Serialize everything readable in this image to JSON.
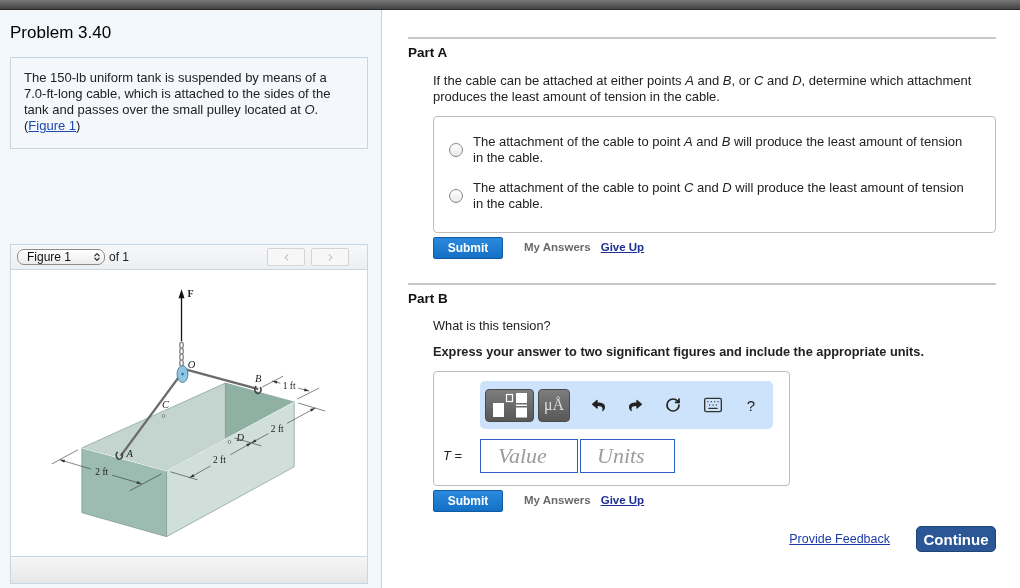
{
  "problem": {
    "title": "Problem 3.40",
    "description": "The 150-lb uniform tank is suspended by means of a 7.0-ft-long cable, which is attached to the sides of the tank and passes over the small pulley located at *O*.",
    "link_open": "(",
    "figure_link": "Figure 1",
    "link_close": ")"
  },
  "figure_viewer": {
    "select": "Figure 1",
    "count": "of 1",
    "nav": [
      {
        "kind": "previous",
        "disabled": true
      },
      {
        "kind": "next",
        "disabled": true
      }
    ],
    "labels": [
      {
        "text": "F",
        "kind": "force"
      },
      {
        "text": "O",
        "kind": "point"
      },
      {
        "text": "B",
        "kind": "point"
      },
      {
        "text": "1 ft",
        "kind": "dimension"
      },
      {
        "text": "C",
        "kind": "point"
      },
      {
        "text": "2 ft",
        "kind": "dimension"
      },
      {
        "text": "D",
        "kind": "point"
      },
      {
        "text": "2 ft",
        "kind": "dimension"
      },
      {
        "text": "A",
        "kind": "point"
      },
      {
        "text": "2 ft",
        "kind": "dimension"
      }
    ]
  },
  "parts": [
    {
      "title": "Part A",
      "kind": "choice",
      "question": "If the cable can be attached at either points *A* and *B*, or *C* and *D*, determine which attachment produces the least amount of tension in the cable.",
      "options": [
        {
          "text": "The attachment of the cable to point *A* and *B* will produce the least amount of tension in the cable.",
          "selected": false
        },
        {
          "text": "The attachment of the cable to point *C* and *D* will produce the least amount of tension in the cable.",
          "selected": false
        }
      ],
      "actions": {
        "submit": "Submit",
        "my_answers": "My Answers",
        "give_up": "Give Up"
      }
    },
    {
      "title": "Part B",
      "kind": "numeric",
      "question": "What is this tension?",
      "instruction": "Express your answer to two significant figures and include the appropriate units.",
      "toolbar": [
        {
          "kind": "templates"
        },
        {
          "kind": "units",
          "label": "μÅ"
        },
        {
          "kind": "undo"
        },
        {
          "kind": "redo"
        },
        {
          "kind": "reset"
        },
        {
          "kind": "keyboard"
        },
        {
          "kind": "help",
          "label": "?"
        }
      ],
      "answer_label": "*T* =",
      "value_placeholder": "Value",
      "units_placeholder": "Units",
      "actions": {
        "submit": "Submit",
        "my_answers": "My Answers",
        "give_up": "Give Up"
      }
    }
  ],
  "footer": {
    "feedback_link": "Provide Feedback",
    "continue_button": "Continue"
  }
}
